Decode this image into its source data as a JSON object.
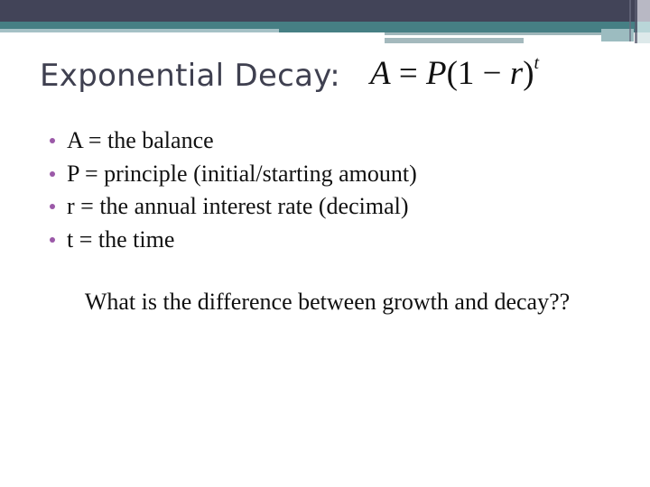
{
  "slide": {
    "title": "Exponential Decay:",
    "formula": {
      "lhs": "A",
      "equals": "=",
      "p": "P",
      "open": "(1 − ",
      "r": "r",
      "close": ")",
      "exponent": "t"
    },
    "bullets": [
      {
        "text": "A = the balance"
      },
      {
        "text": "P = principle (initial/starting amount)"
      },
      {
        "text": "r = the annual interest rate (decimal)"
      },
      {
        "text": "t = the time"
      }
    ],
    "question": "What is the difference between growth and decay??"
  },
  "colors": {
    "header_dark": "#424458",
    "header_teal": "#467f84",
    "title_text": "#3f4050",
    "bullet": "#9b59a8"
  }
}
